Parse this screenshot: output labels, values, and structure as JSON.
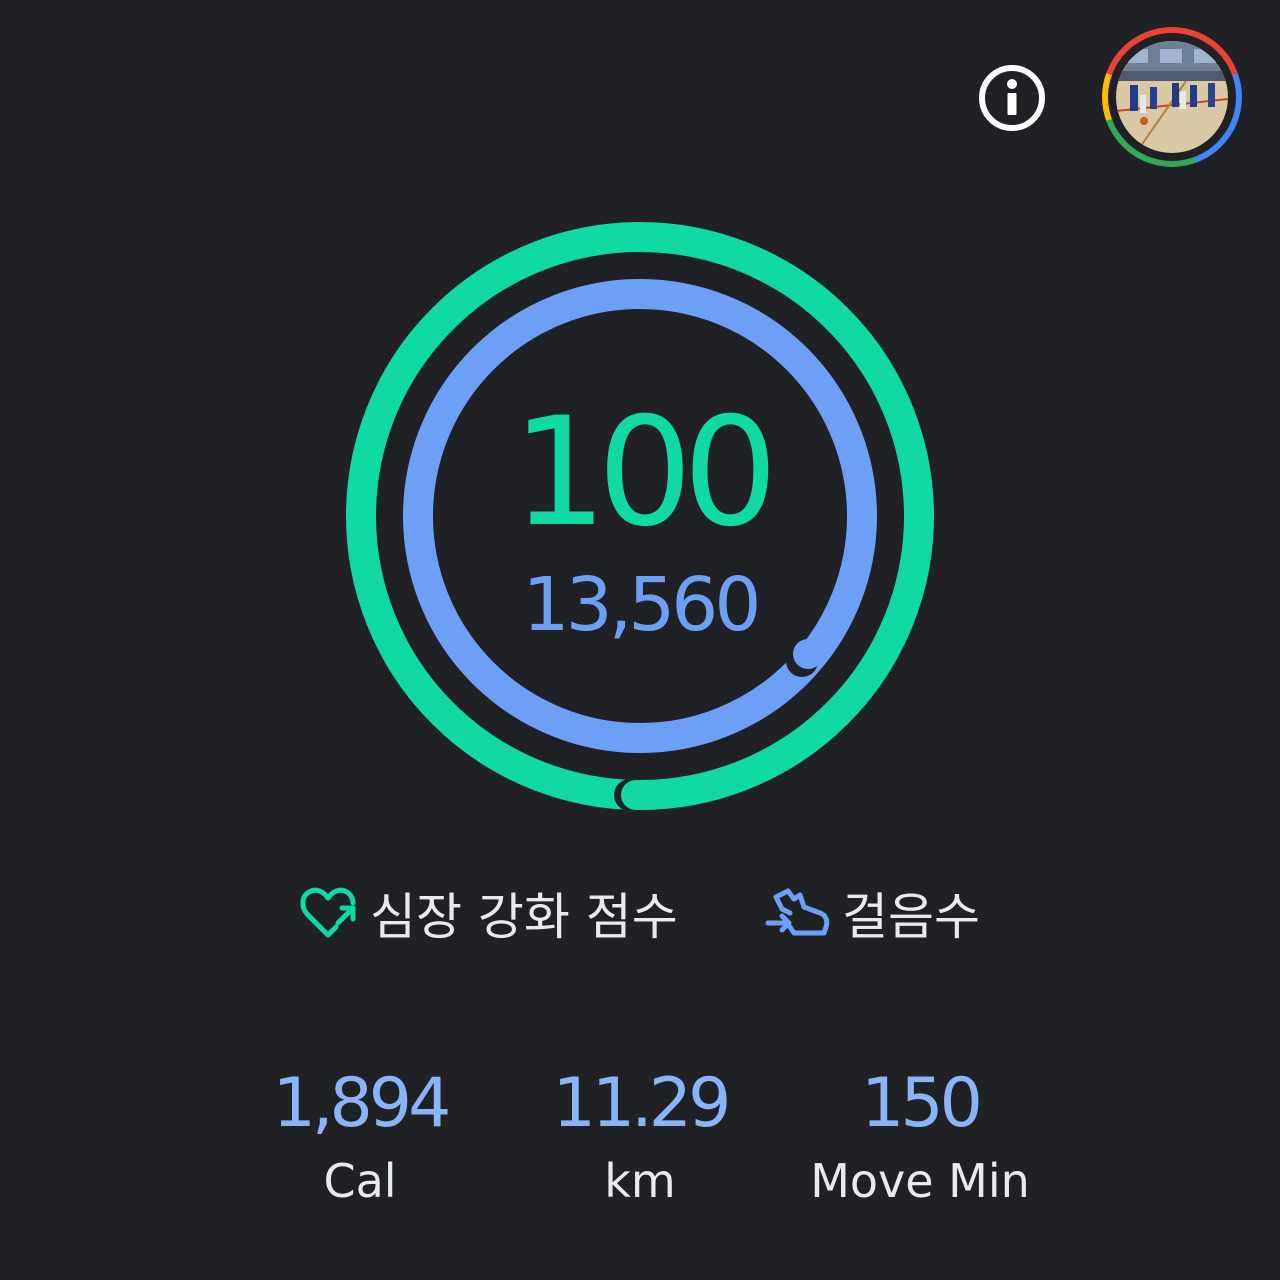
{
  "header": {
    "info_icon": "info-icon",
    "avatar_icon": "profile-avatar"
  },
  "rings": {
    "heart_points": "100",
    "steps": "13,560",
    "heart_points_color": "#11d9a4",
    "steps_color": "#6d9ff6",
    "heart_points_progress": 1.0,
    "steps_progress": 1.0
  },
  "legend": {
    "heart_points_label": "심장 강화 점수",
    "steps_label": "걸음수"
  },
  "stats": {
    "calories_value": "1,894",
    "calories_label": "Cal",
    "distance_value": "11.29",
    "distance_label": "km",
    "move_min_value": "150",
    "move_min_label": "Move Min"
  }
}
